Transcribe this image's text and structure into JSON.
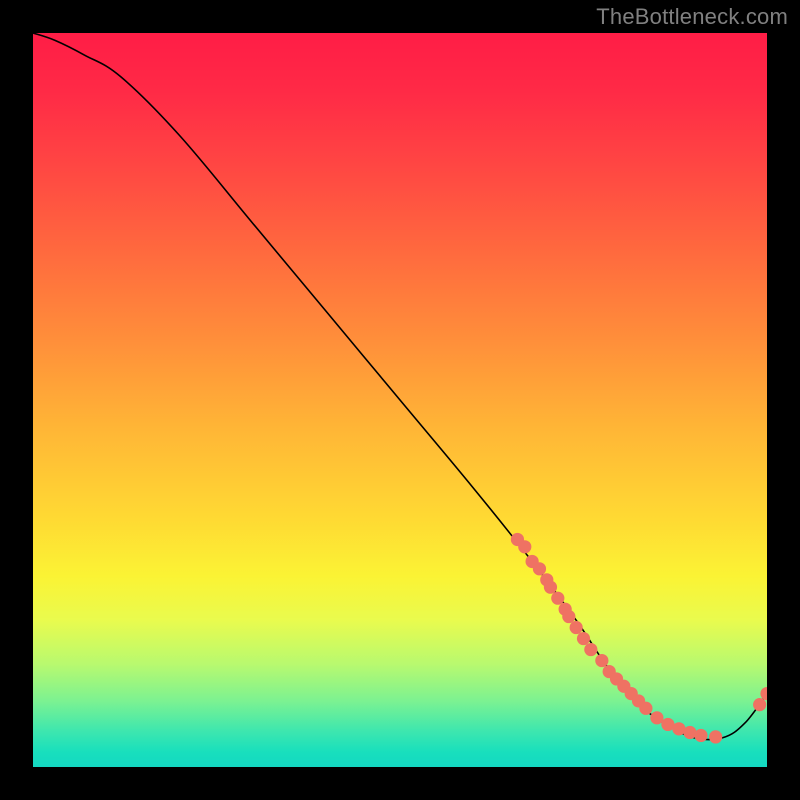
{
  "watermark": "TheBottleneck.com",
  "colors": {
    "dot": "#ef7263",
    "curve": "#000000",
    "background_top": "#ff1d46",
    "background_bottom": "#14d8c2",
    "page": "#000000",
    "watermark": "#808080"
  },
  "chart_data": {
    "type": "line",
    "title": "",
    "xlabel": "",
    "ylabel": "",
    "xlim": [
      0,
      100
    ],
    "ylim": [
      0,
      100
    ],
    "curve": {
      "x": [
        0,
        3,
        7,
        12,
        20,
        30,
        40,
        50,
        60,
        68,
        74,
        78,
        82,
        86,
        90,
        94,
        97,
        100
      ],
      "y": [
        100,
        99,
        97,
        94,
        86,
        74,
        62,
        50,
        38,
        28,
        20,
        14,
        9,
        6,
        4,
        4,
        6,
        10
      ]
    },
    "series": [
      {
        "name": "scatter-on-curve",
        "type": "scatter",
        "x": [
          66,
          67,
          68,
          69,
          70,
          70.5,
          71.5,
          72.5,
          73,
          74,
          75,
          76,
          77.5,
          78.5,
          79.5,
          80.5,
          81.5,
          82.5,
          83.5,
          85,
          86.5,
          88,
          89.5,
          91,
          93,
          99,
          100
        ],
        "y": [
          31,
          30,
          28,
          27,
          25.5,
          24.5,
          23,
          21.5,
          20.5,
          19,
          17.5,
          16,
          14.5,
          13,
          12,
          11,
          10,
          9,
          8,
          6.7,
          5.8,
          5.2,
          4.7,
          4.3,
          4.1,
          8.5,
          10
        ]
      }
    ],
    "annotations": [],
    "legend": null
  }
}
